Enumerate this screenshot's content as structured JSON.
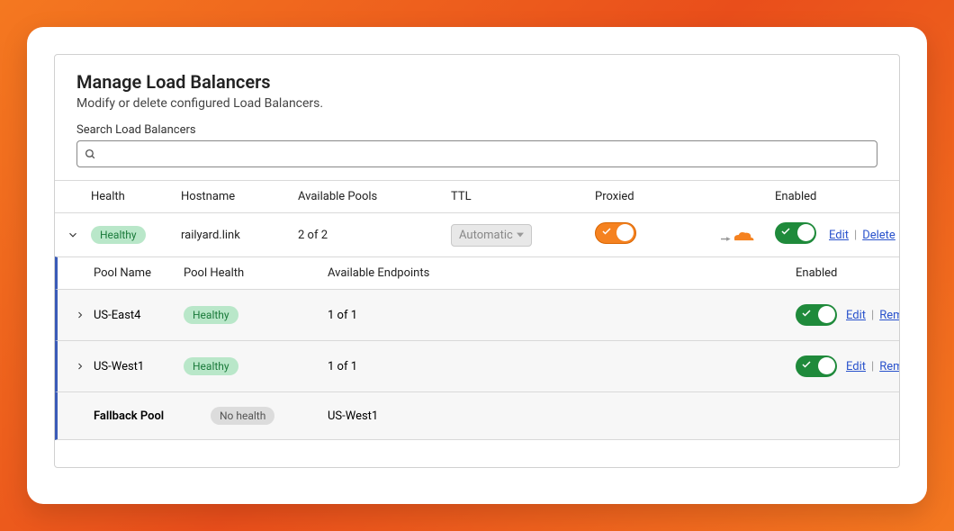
{
  "panel": {
    "title": "Manage Load Balancers",
    "subtitle": "Modify or delete configured Load Balancers.",
    "search_label": "Search Load Balancers"
  },
  "columns": {
    "health": "Health",
    "hostname": "Hostname",
    "available_pools": "Available Pools",
    "ttl": "TTL",
    "proxied": "Proxied",
    "enabled": "Enabled"
  },
  "lb": {
    "health": "Healthy",
    "hostname": "railyard.link",
    "available_pools": "2 of 2",
    "ttl": "Automatic",
    "edit": "Edit",
    "delete": "Delete"
  },
  "sub_columns": {
    "pool_name": "Pool Name",
    "pool_health": "Pool Health",
    "available_endpoints": "Available Endpoints",
    "enabled": "Enabled"
  },
  "pools": [
    {
      "name": "US-East4",
      "health": "Healthy",
      "endpoints": "1 of 1",
      "edit": "Edit",
      "remove": "Remove"
    },
    {
      "name": "US-West1",
      "health": "Healthy",
      "endpoints": "1 of 1",
      "edit": "Edit",
      "remove": "Remove"
    }
  ],
  "fallback": {
    "label": "Fallback Pool",
    "health": "No health",
    "pool": "US-West1"
  }
}
